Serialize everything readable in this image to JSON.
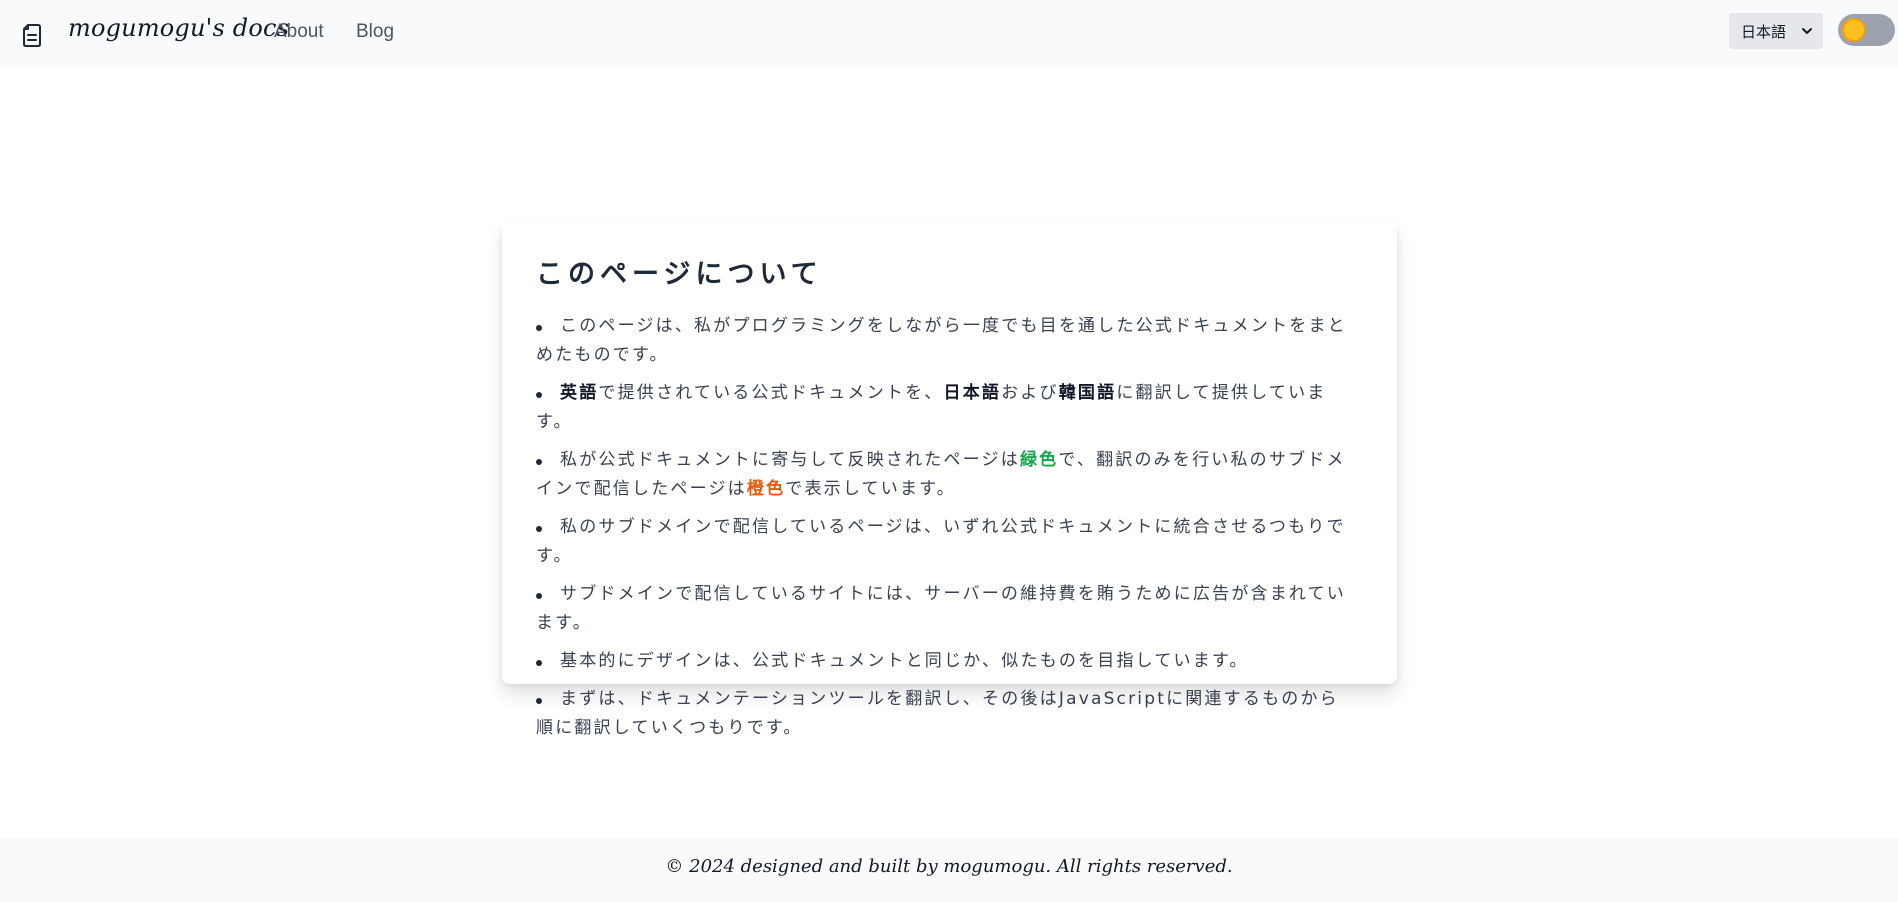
{
  "header": {
    "logo_icon": "document-icon",
    "brand": "mogumogu's docs",
    "nav": [
      {
        "label": "About"
      },
      {
        "label": "Blog"
      }
    ],
    "language_select": {
      "value": "日本語"
    },
    "theme_toggle": {
      "state": "light",
      "knob_color": "#fbbf24"
    }
  },
  "main": {
    "title": "このページについて",
    "items": [
      {
        "text": "このページは、私がプログラミングをしながら一度でも目を通した公式ドキュメントをまとめたものです。"
      },
      {
        "b1": "英語",
        "t1": "で提供されている公式ドキュメントを、",
        "b2": "日本語",
        "t2": "および",
        "b3": "韓国語",
        "t3": "に翻訳して提供しています。"
      },
      {
        "t1": "私が公式ドキュメントに寄与して反映されたページは",
        "green": "緑色",
        "t2": "で、翻訳のみを行い私のサブドメインで配信したページは",
        "orange": "橙色",
        "t3": "で表示しています。"
      },
      {
        "text": "私のサブドメインで配信しているページは、いずれ公式ドキュメントに統合させるつもりです。"
      },
      {
        "text": "サブドメインで配信しているサイトには、サーバーの維持費を賄うために広告が含まれています。"
      },
      {
        "text": "基本的にデザインは、公式ドキュメントと同じか、似たものを目指しています。"
      },
      {
        "text": "まずは、ドキュメンテーションツールを翻訳し、その後はJavaScriptに関連するものから順に翻訳していくつもりです。"
      }
    ],
    "colors": {
      "green": "#16a34a",
      "orange": "#ea580c"
    }
  },
  "footer": {
    "text": "© 2024 designed and built by mogumogu. All rights reserved."
  }
}
